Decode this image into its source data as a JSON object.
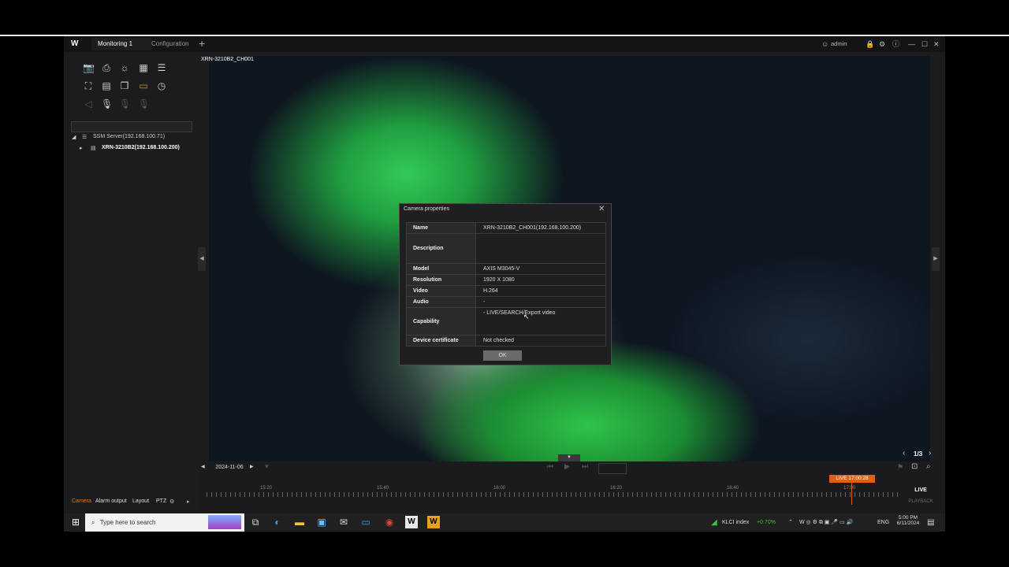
{
  "app": {
    "logo": "W",
    "tabs": [
      {
        "label": "Monitoring 1"
      },
      {
        "label": "Configuration"
      }
    ],
    "add_tab": "+",
    "user": "admin",
    "window_icons": {
      "lock": "🔒",
      "gear": "⚙",
      "info": "ⓘ",
      "min": "—",
      "max": "☐",
      "close": "✕"
    }
  },
  "toolbar": {
    "icons": [
      "camera-icon",
      "print-icon",
      "alarm-icon",
      "layout-icon",
      "list-icon",
      "fullscreen-icon",
      "grid-icon",
      "sequence-icon",
      "monitor-icon",
      "history-icon",
      "speaker-icon",
      "mic-icon",
      "mic-off-icon",
      "mic-group-icon"
    ]
  },
  "tree": {
    "server": "SSM Server(192.168.100.71)",
    "device": "XRN-3210B2(192.168.100.200)"
  },
  "viewer": {
    "channel_label": "XRN-3210B2_CH001",
    "page_indicator": "1/3",
    "date": "2024-11-06",
    "live_time": "LIVE 17:00:28",
    "live": "LIVE",
    "playback": "PLAYBACK",
    "ticks": [
      "15:20",
      "15:40",
      "16:00",
      "16:20",
      "16:40",
      "17:00"
    ]
  },
  "bottom_tabs": [
    "Camera",
    "Alarm output",
    "Layout",
    "PTZ"
  ],
  "dialog": {
    "title": "Camera properties",
    "close": "✕",
    "rows": [
      {
        "key": "Name",
        "value": "XRN-3210B2_CH001(192.168.100.200)"
      },
      {
        "key": "Description",
        "value": ""
      },
      {
        "key": "Model",
        "value": "AXIS M3045-V"
      },
      {
        "key": "Resolution",
        "value": "1920 X 1080"
      },
      {
        "key": "Video",
        "value": "H.264"
      },
      {
        "key": "Audio",
        "value": "-"
      },
      {
        "key": "Capability",
        "value": "- LIVE/SEARCH/Export video"
      },
      {
        "key": "Device certificate",
        "value": "Not checked"
      }
    ],
    "ok": "OK"
  },
  "taskbar": {
    "search_placeholder": "Type here to search",
    "stock_name": "KLCI index",
    "stock_change": "+0.70%",
    "lang": "ENG",
    "time": "5:00 PM",
    "date": "6/11/2024"
  }
}
